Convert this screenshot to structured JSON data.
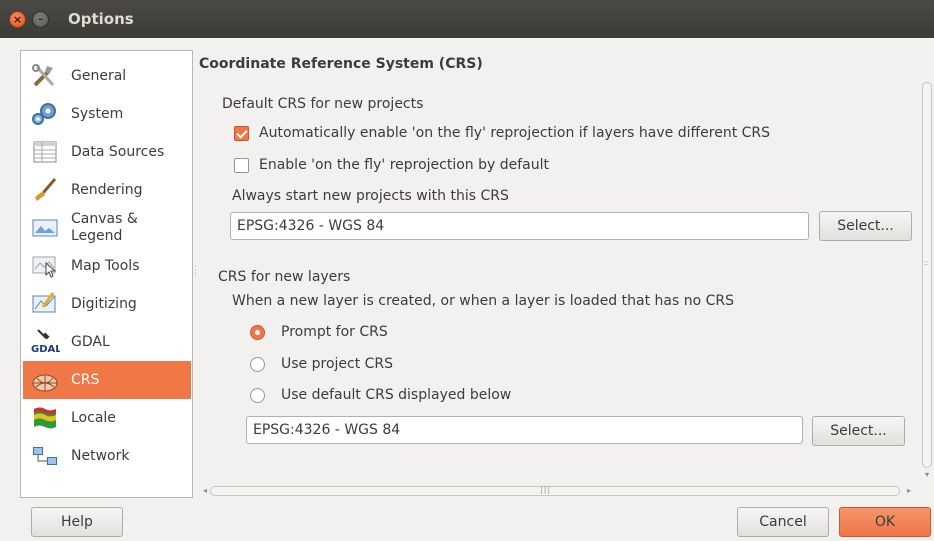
{
  "window": {
    "title": "Options"
  },
  "sidebar": {
    "items": [
      {
        "label": "General",
        "icon": "tools-icon"
      },
      {
        "label": "System",
        "icon": "gears-icon"
      },
      {
        "label": "Data Sources",
        "icon": "table-icon"
      },
      {
        "label": "Rendering",
        "icon": "brush-icon"
      },
      {
        "label": "Canvas &\nLegend",
        "icon": "canvas-icon"
      },
      {
        "label": "Map Tools",
        "icon": "map-tools-icon"
      },
      {
        "label": "Digitizing",
        "icon": "digitizing-icon"
      },
      {
        "label": "GDAL",
        "icon": "gdal-icon"
      },
      {
        "label": "CRS",
        "icon": "globe-icon"
      },
      {
        "label": "Locale",
        "icon": "flag-icon"
      },
      {
        "label": "Network",
        "icon": "network-icon"
      }
    ],
    "selected_index": 8
  },
  "crs_page": {
    "section_title": "Coordinate Reference System (CRS)",
    "default_group": {
      "title": "Default CRS for new projects",
      "auto_reproject_label": "Automatically enable 'on the fly' reprojection if layers have different CRS",
      "auto_reproject_checked": true,
      "enable_otf_label": "Enable 'on the fly' reprojection by default",
      "enable_otf_checked": false,
      "always_start_label": "Always start new projects with this CRS",
      "project_crs_value": "EPSG:4326 - WGS 84",
      "select_label": "Select..."
    },
    "layers_group": {
      "title": "CRS for new layers",
      "description": "When a new layer is created, or when a layer is loaded that has no CRS",
      "options": [
        {
          "label": "Prompt for CRS",
          "checked": true
        },
        {
          "label": "Use project CRS",
          "checked": false
        },
        {
          "label": "Use default CRS displayed below",
          "checked": false
        }
      ],
      "layer_crs_value": "EPSG:4326 - WGS 84",
      "select_label": "Select..."
    }
  },
  "footer": {
    "help_label": "Help",
    "cancel_label": "Cancel",
    "ok_label": "OK"
  },
  "colors": {
    "accent": "#f07746",
    "titlebar": "#3c3b37"
  }
}
